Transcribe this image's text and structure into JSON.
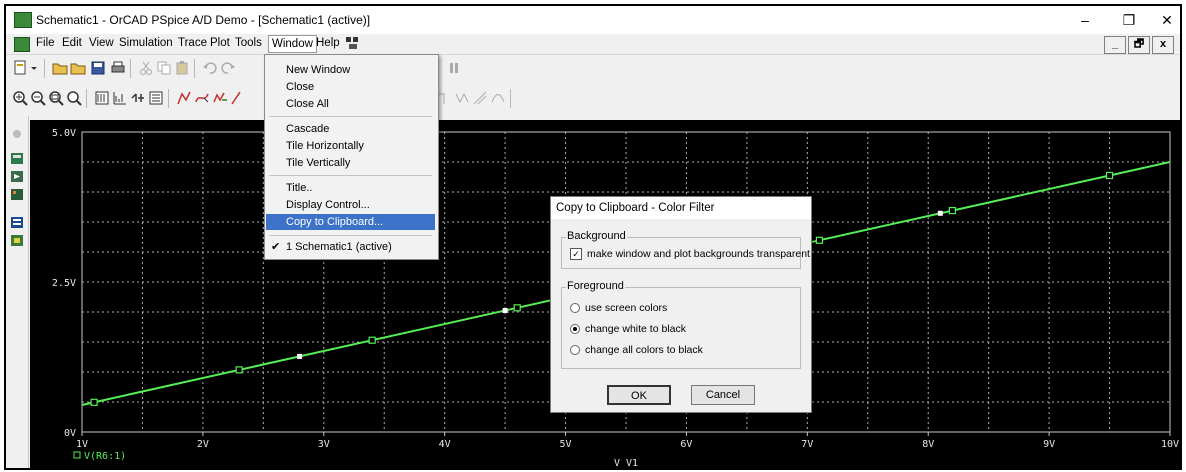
{
  "window": {
    "title": "Schematic1 - OrCAD PSpice A/D Demo - [Schematic1 (active)]",
    "minimize": "–",
    "maximize": "❐",
    "close": "✕"
  },
  "menubar": {
    "items": [
      "File",
      "Edit",
      "View",
      "Simulation",
      "Trace",
      "Plot",
      "Tools",
      "Window",
      "Help"
    ],
    "active": "Window",
    "mdi_minimize": "_",
    "mdi_restore": "🗗",
    "mdi_close": "x"
  },
  "window_menu": {
    "items": [
      {
        "label": "New Window"
      },
      {
        "label": "Close"
      },
      {
        "label": "Close All"
      },
      {
        "label": "Cascade"
      },
      {
        "label": "Tile Horizontally"
      },
      {
        "label": "Tile Vertically"
      },
      {
        "label": "Title.."
      },
      {
        "label": "Display Control..."
      },
      {
        "label": "Copy to Clipboard...",
        "highlighted": true
      },
      {
        "label": "1 Schematic1 (active)",
        "checked": true
      }
    ],
    "check_mark": "✔"
  },
  "dialog": {
    "title": "Copy to Clipboard - Color Filter",
    "background_group": "Background",
    "transparent_option": "make window and plot backgrounds transparent",
    "transparent_checked": true,
    "check_glyph": "✓",
    "foreground_group": "Foreground",
    "fg_options": [
      "use screen colors",
      "change white to black",
      "change all colors to black"
    ],
    "fg_selected": 1,
    "ok": "OK",
    "cancel": "Cancel"
  },
  "chart_data": {
    "type": "line",
    "xlabel": "V_V1",
    "x_ticks": [
      "1V",
      "2V",
      "3V",
      "4V",
      "5V",
      "6V",
      "7V",
      "8V",
      "9V",
      "10V"
    ],
    "y_ticks": [
      "0V",
      "2.5V",
      "5.0V"
    ],
    "xlim": [
      1,
      10
    ],
    "ylim": [
      0,
      5
    ],
    "grid": true,
    "series": [
      {
        "name": "V(R6:1)",
        "color": "#55ee55",
        "x": [
          1,
          10
        ],
        "y": [
          0.45,
          4.5
        ],
        "markers_x": [
          1.1,
          2.3,
          3.4,
          4.6,
          5.8,
          7.1,
          8.2,
          9.5
        ],
        "white_markers_x": [
          2.8,
          4.5,
          8.1
        ]
      }
    ],
    "background": "#000000",
    "axis_color": "#c8c8c8",
    "grid_color": "#b0b0b0"
  }
}
